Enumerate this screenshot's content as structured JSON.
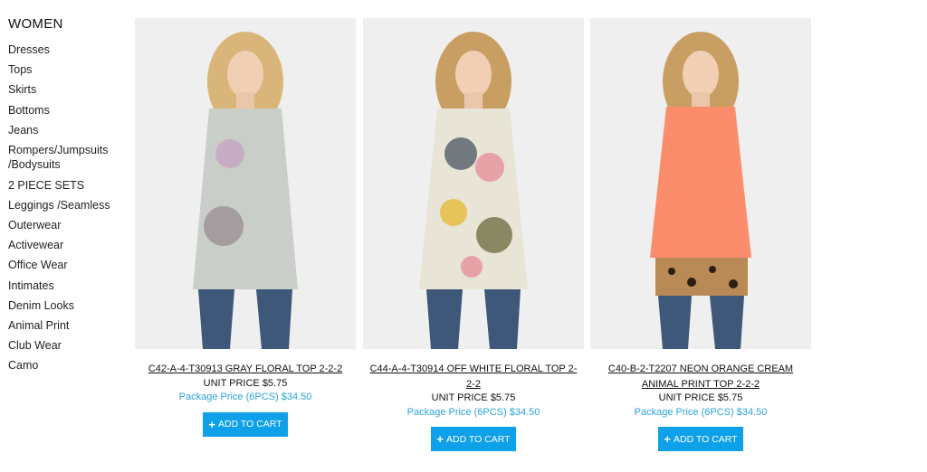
{
  "sidebar": {
    "title": "WOMEN",
    "items": [
      {
        "label": "Dresses"
      },
      {
        "label": "Tops"
      },
      {
        "label": "Skirts"
      },
      {
        "label": "Bottoms"
      },
      {
        "label": "Jeans"
      },
      {
        "label": "Rompers/Jumpsuits /Bodysuits"
      },
      {
        "label": "2 PIECE SETS"
      },
      {
        "label": "Leggings /Seamless"
      },
      {
        "label": "Outerwear"
      },
      {
        "label": "Activewear"
      },
      {
        "label": "Office Wear"
      },
      {
        "label": "Intimates"
      },
      {
        "label": "Denim Looks"
      },
      {
        "label": "Animal Print"
      },
      {
        "label": "Club Wear"
      },
      {
        "label": "Camo"
      }
    ]
  },
  "products": [
    {
      "name": "C42-A-4-T30913 GRAY FLORAL TOP 2-2-2",
      "unit_price": "UNIT PRICE $5.75",
      "package_price": "Package Price (6PCS) $34.50",
      "cart_label": "ADD TO CART",
      "top_color": "#c9cfc8"
    },
    {
      "name": "C44-A-4-T30914 OFF WHITE FLORAL TOP 2-2-2",
      "unit_price": "UNIT PRICE $5.75",
      "package_price": "Package Price (6PCS) $34.50",
      "cart_label": "ADD TO CART",
      "top_color": "#e8e4d6"
    },
    {
      "name": "C40-B-2-T2207 NEON ORANGE CREAM ANIMAL PRINT TOP 2-2-2",
      "unit_price": "UNIT PRICE $5.75",
      "package_price": "Package Price (6PCS) $34.50",
      "cart_label": "ADD TO CART",
      "top_color": "#fb8d6c"
    }
  ],
  "colors": {
    "accent_button": "#0ea0e8",
    "package_price_text": "#2aa4de"
  }
}
